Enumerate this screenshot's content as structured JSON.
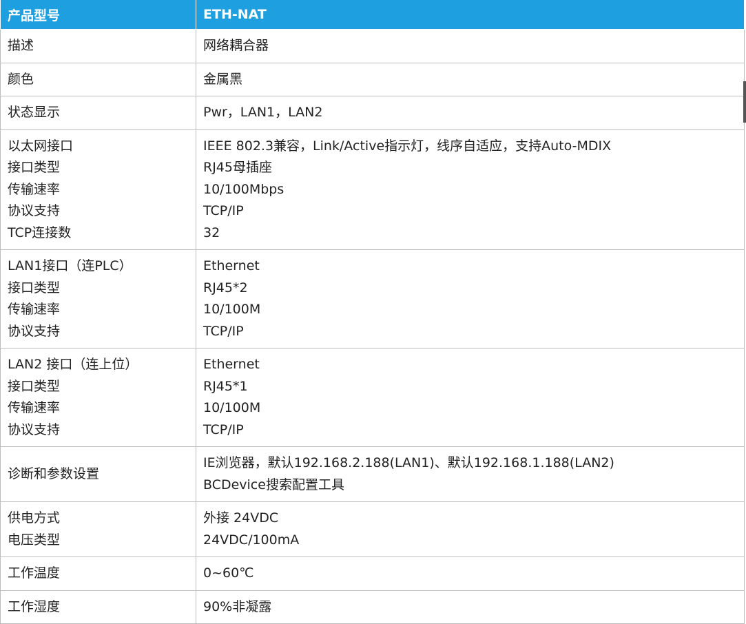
{
  "header": {
    "label": "产品型号",
    "value": "ETH-NAT"
  },
  "rows": [
    {
      "label": [
        "描述"
      ],
      "value": [
        "网络耦合器"
      ]
    },
    {
      "label": [
        "颜色"
      ],
      "value": [
        "金属黑"
      ]
    },
    {
      "label": [
        "状态显示"
      ],
      "value": [
        "Pwr，LAN1，LAN2"
      ]
    },
    {
      "label": [
        "以太网接口",
        "接口类型",
        "传输速率",
        "协议支持",
        "TCP连接数"
      ],
      "value": [
        "IEEE 802.3兼容，Link/Active指示灯，线序自适应，支持Auto-MDIX",
        "RJ45母插座",
        "10/100Mbps",
        "TCP/IP",
        "32"
      ]
    },
    {
      "label": [
        "LAN1接口（连PLC）",
        "接口类型",
        "传输速率",
        "协议支持"
      ],
      "value": [
        "Ethernet",
        "RJ45*2",
        "10/100M",
        "TCP/IP"
      ]
    },
    {
      "label": [
        "LAN2 接口（连上位）",
        "接口类型",
        "传输速率",
        "协议支持"
      ],
      "value": [
        "Ethernet",
        "RJ45*1",
        "10/100M",
        "TCP/IP"
      ]
    },
    {
      "label": [
        "诊断和参数设置"
      ],
      "value": [
        "IE浏览器，默认192.168.2.188(LAN1)、默认192.168.1.188(LAN2)",
        "BCDevice搜索配置工具"
      ]
    },
    {
      "label": [
        "供电方式",
        "电压类型"
      ],
      "value": [
        "外接 24VDC",
        "24VDC/100mA"
      ]
    },
    {
      "label": [
        "工作温度"
      ],
      "value": [
        "0~60℃"
      ]
    },
    {
      "label": [
        "工作湿度"
      ],
      "value": [
        "90%非凝露"
      ]
    }
  ],
  "colors": {
    "header_bg": "#1e9fe0",
    "header_text": "#ffffff",
    "border": "#bdbdbd",
    "text": "#222222"
  }
}
